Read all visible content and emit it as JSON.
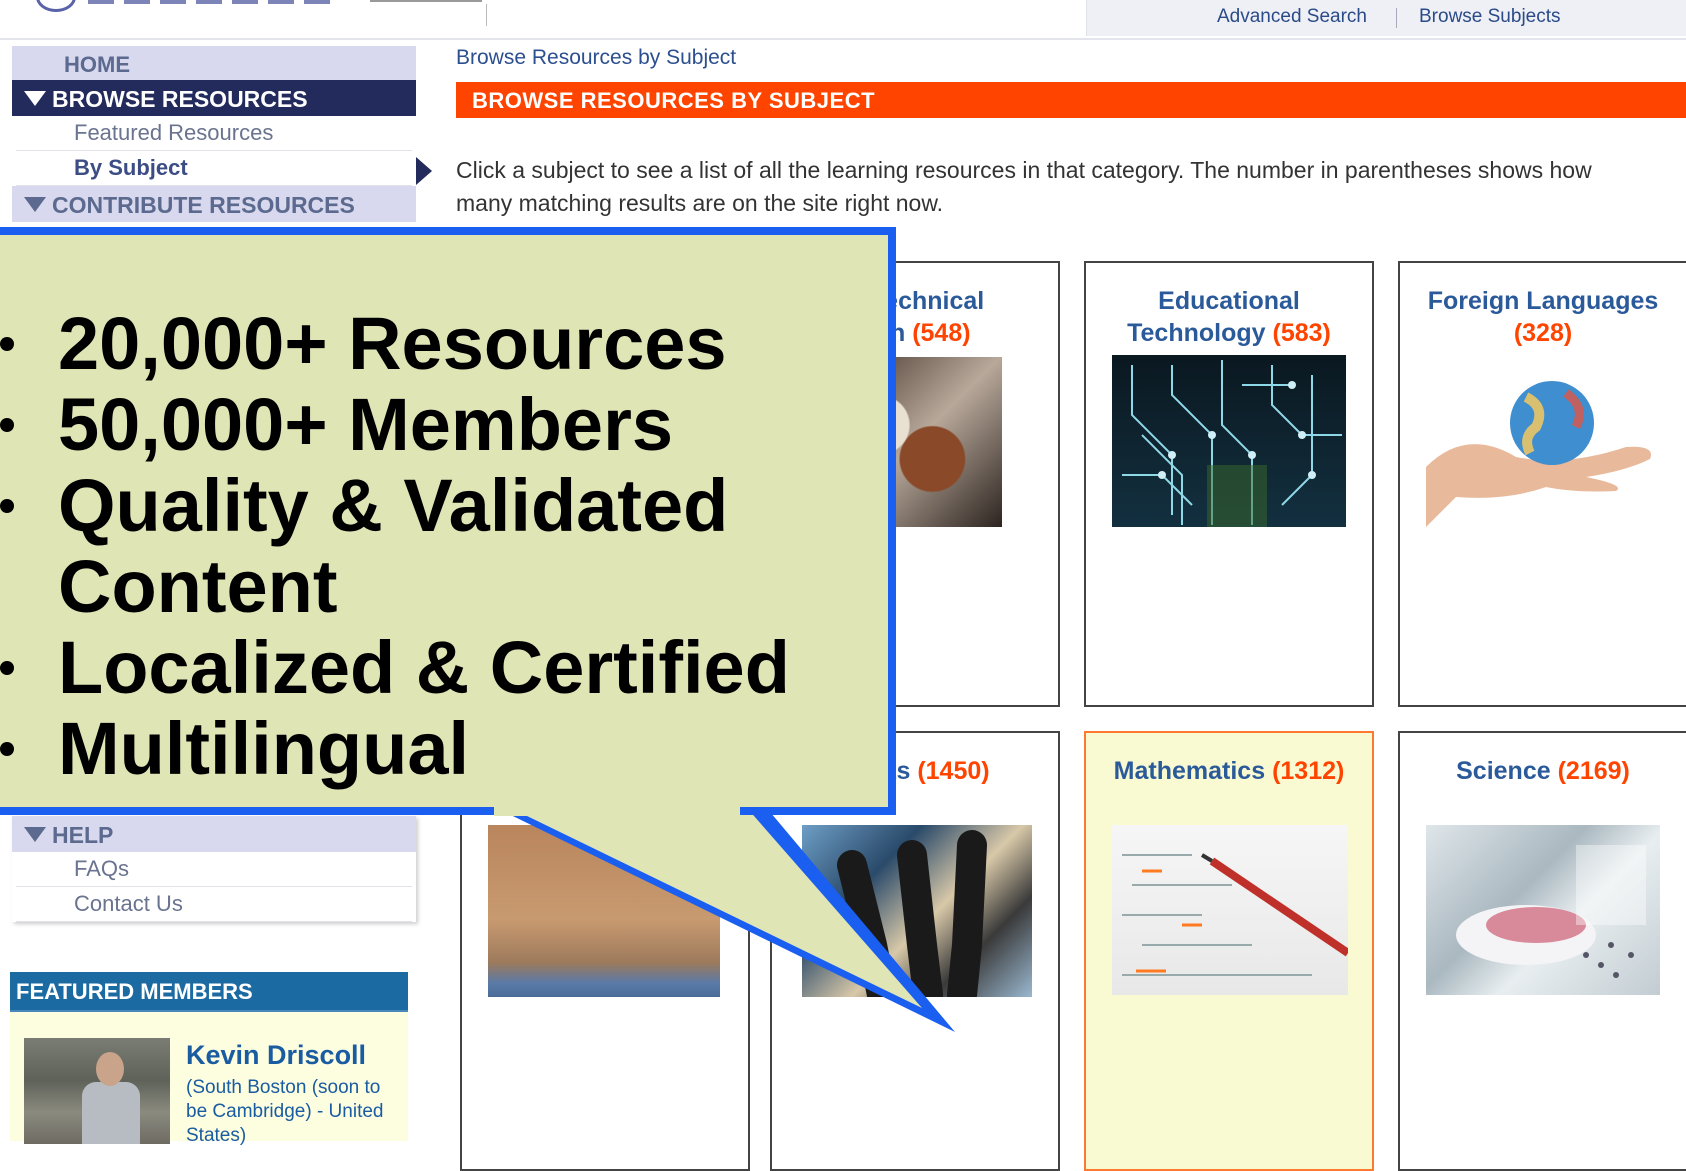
{
  "header": {
    "advanced_search": "Advanced Search",
    "browse_subjects": "Browse Subjects"
  },
  "nav": {
    "home": "HOME",
    "browse_resources": "BROWSE RESOURCES",
    "featured_resources": "Featured Resources",
    "by_subject": "By Subject",
    "contribute_resources": "CONTRIBUTE RESOURCES",
    "help": "HELP",
    "faqs": "FAQs",
    "contact_us": "Contact Us"
  },
  "featured_members": {
    "title": "FEATURED MEMBERS",
    "name": "Kevin Driscoll",
    "location": "(South Boston (soon to be Cambridge) - United States)"
  },
  "main": {
    "breadcrumb": "Browse Resources by Subject",
    "heading": "BROWSE RESOURCES BY SUBJECT",
    "intro": "Click a subject to see a list of all the learning resources in that category. The number in parentheses shows how many matching results are on the site right now."
  },
  "subjects": [
    {
      "line1": "& Technical",
      "line2": "tion",
      "count": "(548)"
    },
    {
      "line1": "Educational",
      "line2": "Technology",
      "count": "(583)"
    },
    {
      "line1": "Foreign Languages",
      "count": "(328)"
    },
    {
      "name": "e Arts",
      "count": "(1450)"
    },
    {
      "name": "Mathematics",
      "count": "(1312)"
    },
    {
      "name": "Science",
      "count": "(2169)"
    }
  ],
  "callout": {
    "items": [
      "20,000+ Resources",
      "50,000+ Members",
      "Quality & Validated Content",
      "Localized & Certified",
      "Multilingual"
    ]
  },
  "colors": {
    "accent_orange": "#ff4400",
    "nav_dark": "#232a5c",
    "callout_bg": "#e0e5b6",
    "callout_border": "#1a5ff0",
    "link_blue": "#2b5a9a"
  }
}
